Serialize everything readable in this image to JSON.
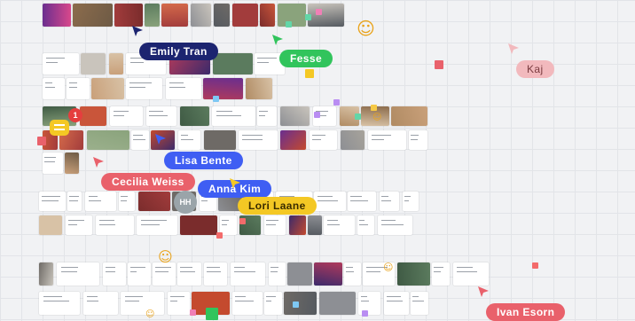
{
  "colors": {
    "background": "#f1f2f4",
    "grid": "#e2e4e8",
    "navy": "#1c2470",
    "green": "#31c45c",
    "blue": "#3f5ef3",
    "coral": "#e9616b",
    "yellow": "#f4c824",
    "pink": "#f2b9bd",
    "avatar": "#9aa4a9",
    "badge": "#e53e3e"
  },
  "collaborators": [
    {
      "name": "Emily Tran"
    },
    {
      "name": "Fesse"
    },
    {
      "name": "Lisa Bente"
    },
    {
      "name": "Cecilia Weiss"
    },
    {
      "name": "Anna Kim"
    },
    {
      "name": "Lori Laane"
    },
    {
      "name": "Kaj"
    },
    {
      "name": "Ivan Esorn"
    }
  ],
  "avatar": {
    "initials": "HH"
  },
  "notification": {
    "count": "1"
  },
  "icons": [
    "cursor-arrow-icon",
    "chat-icon",
    "smiley-emoji-icon",
    "notification-badge"
  ]
}
